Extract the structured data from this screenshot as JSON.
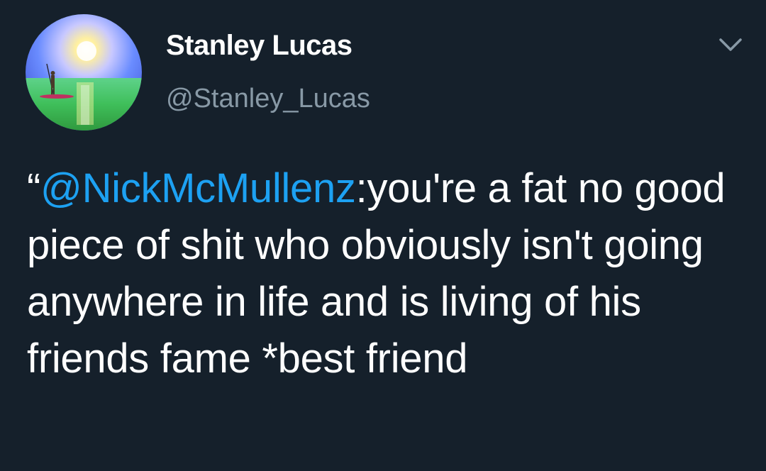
{
  "tweet": {
    "author": {
      "display_name": "Stanley Lucas",
      "handle": "@Stanley_Lucas",
      "avatar_icon": "sunset-paddleboard-avatar"
    },
    "menu_icon": "chevron-down-icon",
    "text": {
      "open_quote": "“",
      "mention": "@NickMcMullenz",
      "body": ":you're a fat no good piece of shit who obviously isn't going anywhere in life and is living of his friends fame *best friend"
    },
    "colors": {
      "background": "#15202b",
      "mention": "#1da1f2",
      "secondary_text": "#8899a6"
    }
  }
}
